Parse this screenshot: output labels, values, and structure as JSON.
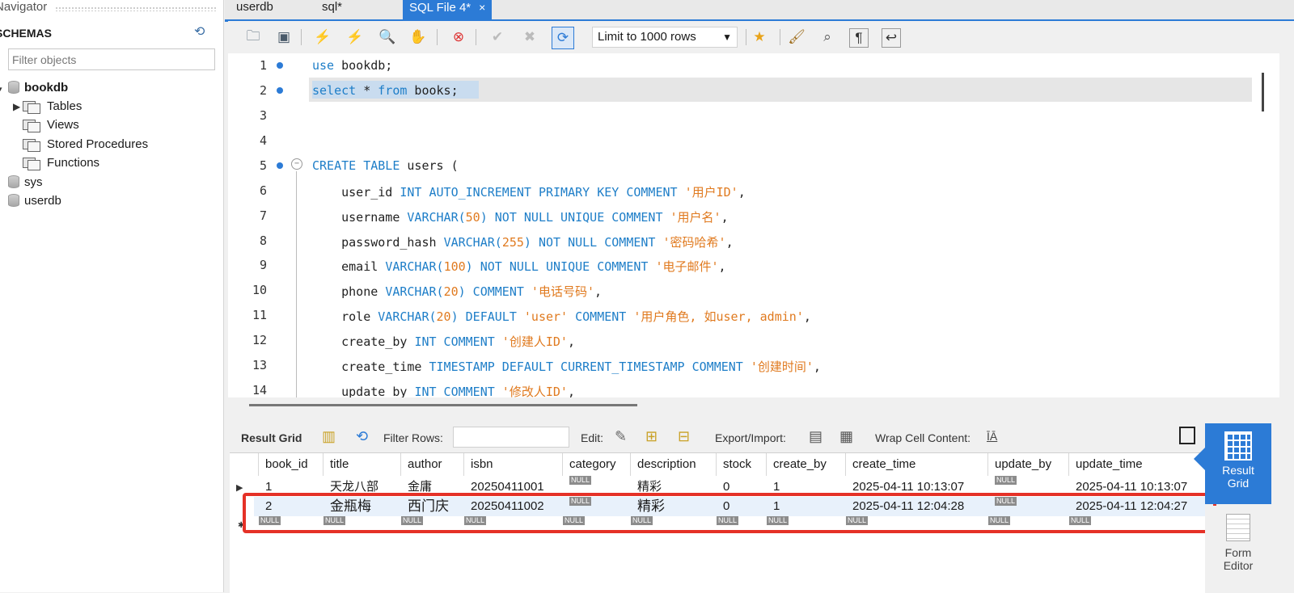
{
  "navigator": {
    "title": "Navigator",
    "schemas_label": "SCHEMAS",
    "filter_placeholder": "Filter objects",
    "schemas": [
      {
        "name": "bookdb",
        "children": [
          "Tables",
          "Views",
          "Stored Procedures",
          "Functions"
        ]
      },
      {
        "name": "sys"
      },
      {
        "name": "userdb"
      }
    ]
  },
  "tabs": [
    {
      "label": "userdb"
    },
    {
      "label": "sql*"
    },
    {
      "label": "SQL File 4*",
      "close": "×"
    }
  ],
  "toolbar": {
    "limit_label": "Limit to 1000 rows",
    "icons": [
      "open-folder-icon",
      "save-icon",
      "execute-icon",
      "execute-current-icon",
      "explain-icon",
      "stop-icon",
      "toggle-error-icon",
      "commit-icon",
      "rollback-icon",
      "autocommit-icon",
      "limit-dropdown",
      "bookmark-icon",
      "beautify-icon",
      "find-icon",
      "invisible-chars-icon",
      "wrap-icon"
    ]
  },
  "editor": {
    "lines": [
      "1",
      "2",
      "3",
      "4",
      "5",
      "6",
      "7",
      "8",
      "9",
      "10",
      "11",
      "12",
      "13",
      "14"
    ],
    "code": {
      "l1a": "use",
      "l1b": " bookdb;",
      "l2a": "select",
      "l2b": " * ",
      "l2c": "from",
      "l2d": " books;",
      "l5a": "CREATE TABLE",
      "l5b": " users (",
      "l6a": "    user_id ",
      "l6b": "INT AUTO_INCREMENT PRIMARY KEY COMMENT",
      "l6c": " '用户ID'",
      "l6d": ",",
      "l7a": "    username ",
      "l7b": "VARCHAR(",
      "l7c": "50",
      "l7d": ") NOT NULL UNIQUE COMMENT",
      "l7e": " '用户名'",
      "l7f": ",",
      "l8a": "    password_hash ",
      "l8b": "VARCHAR(",
      "l8c": "255",
      "l8d": ") NOT NULL COMMENT",
      "l8e": " '密码哈希'",
      "l8f": ",",
      "l9a": "    email ",
      "l9b": "VARCHAR(",
      "l9c": "100",
      "l9d": ") NOT NULL UNIQUE COMMENT",
      "l9e": " '电子邮件'",
      "l9f": ",",
      "l10a": "    phone ",
      "l10b": "VARCHAR(",
      "l10c": "20",
      "l10d": ") COMMENT",
      "l10e": " '电话号码'",
      "l10f": ",",
      "l11a": "    role ",
      "l11b": "VARCHAR(",
      "l11c": "20",
      "l11d": ") DEFAULT",
      "l11e": " 'user'",
      "l11f": " COMMENT",
      "l11g": " '用户角色, 如user, admin'",
      "l11h": ",",
      "l12a": "    create_by ",
      "l12b": "INT COMMENT",
      "l12c": " '创建人ID'",
      "l12d": ",",
      "l13a": "    create_time ",
      "l13b": "TIMESTAMP DEFAULT CURRENT_TIMESTAMP COMMENT",
      "l13c": " '创建时间'",
      "l13d": ",",
      "l14a": "    update_by ",
      "l14b": "INT COMMENT",
      "l14c": " '修改人ID'",
      "l14d": ","
    }
  },
  "result_toolbar": {
    "result_grid": "Result Grid",
    "filter_rows": "Filter Rows:",
    "edit": "Edit:",
    "export_import": "Export/Import:",
    "wrap_cell": "Wrap Cell Content:"
  },
  "grid": {
    "columns": [
      "book_id",
      "title",
      "author",
      "isbn",
      "category",
      "description",
      "stock",
      "create_by",
      "create_time",
      "update_by",
      "update_time"
    ],
    "rows": [
      [
        "1",
        "天龙八部",
        "金庸",
        "20250411001",
        "NULL",
        "精彩",
        "0",
        "1",
        "2025-04-11 10:13:07",
        "NULL",
        "2025-04-11 10:13:07"
      ],
      [
        "2",
        "金瓶梅",
        "西门庆",
        "20250411002",
        "NULL",
        "精彩",
        "0",
        "1",
        "2025-04-11 12:04:28",
        "NULL",
        "2025-04-11 12:04:27"
      ]
    ],
    "null_label": "NULL"
  },
  "side": {
    "result_grid": [
      "Result",
      "Grid"
    ],
    "form_editor": [
      "Form",
      "Editor"
    ]
  },
  "colors": {
    "accent": "#2c7bd6",
    "highlight_box": "#e53127",
    "keyword": "#1e7ec8",
    "string": "#e07a1f"
  }
}
